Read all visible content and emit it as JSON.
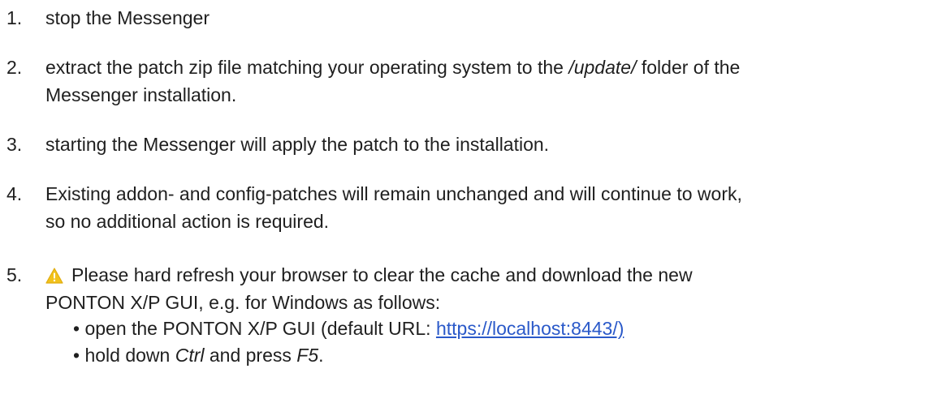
{
  "steps": [
    {
      "number": "1.",
      "text": "stop the Messenger"
    },
    {
      "number": "2.",
      "text_before": "extract the patch zip file matching your operating system to the ",
      "italic": "/update/",
      "text_after": " folder of the",
      "line2": "Messenger installation."
    },
    {
      "number": "3.",
      "text": "starting the Messenger will apply the patch to the installation."
    },
    {
      "number": "4.",
      "line1": "Existing addon- and config-patches will remain unchanged and will continue to work,",
      "line2": "so no additional action is required."
    },
    {
      "number": "5.",
      "icon": "warning-icon",
      "line1": "Please hard refresh your browser to clear the cache and download the new",
      "line2": "PONTON X/P GUI, e.g. for Windows as follows:",
      "bullets": {
        "first_text": "• open the PONTON X/P GUI (default URL: ",
        "first_link": "https://localhost:8443/)",
        "second_prefix": "• hold down ",
        "second_key1": "Ctrl",
        "second_middle": " and press ",
        "second_key2": "F5",
        "second_end": "."
      }
    }
  ],
  "colors": {
    "text": "#1f1f1f",
    "link": "#2a59c9",
    "warning": "#f2c21b"
  }
}
